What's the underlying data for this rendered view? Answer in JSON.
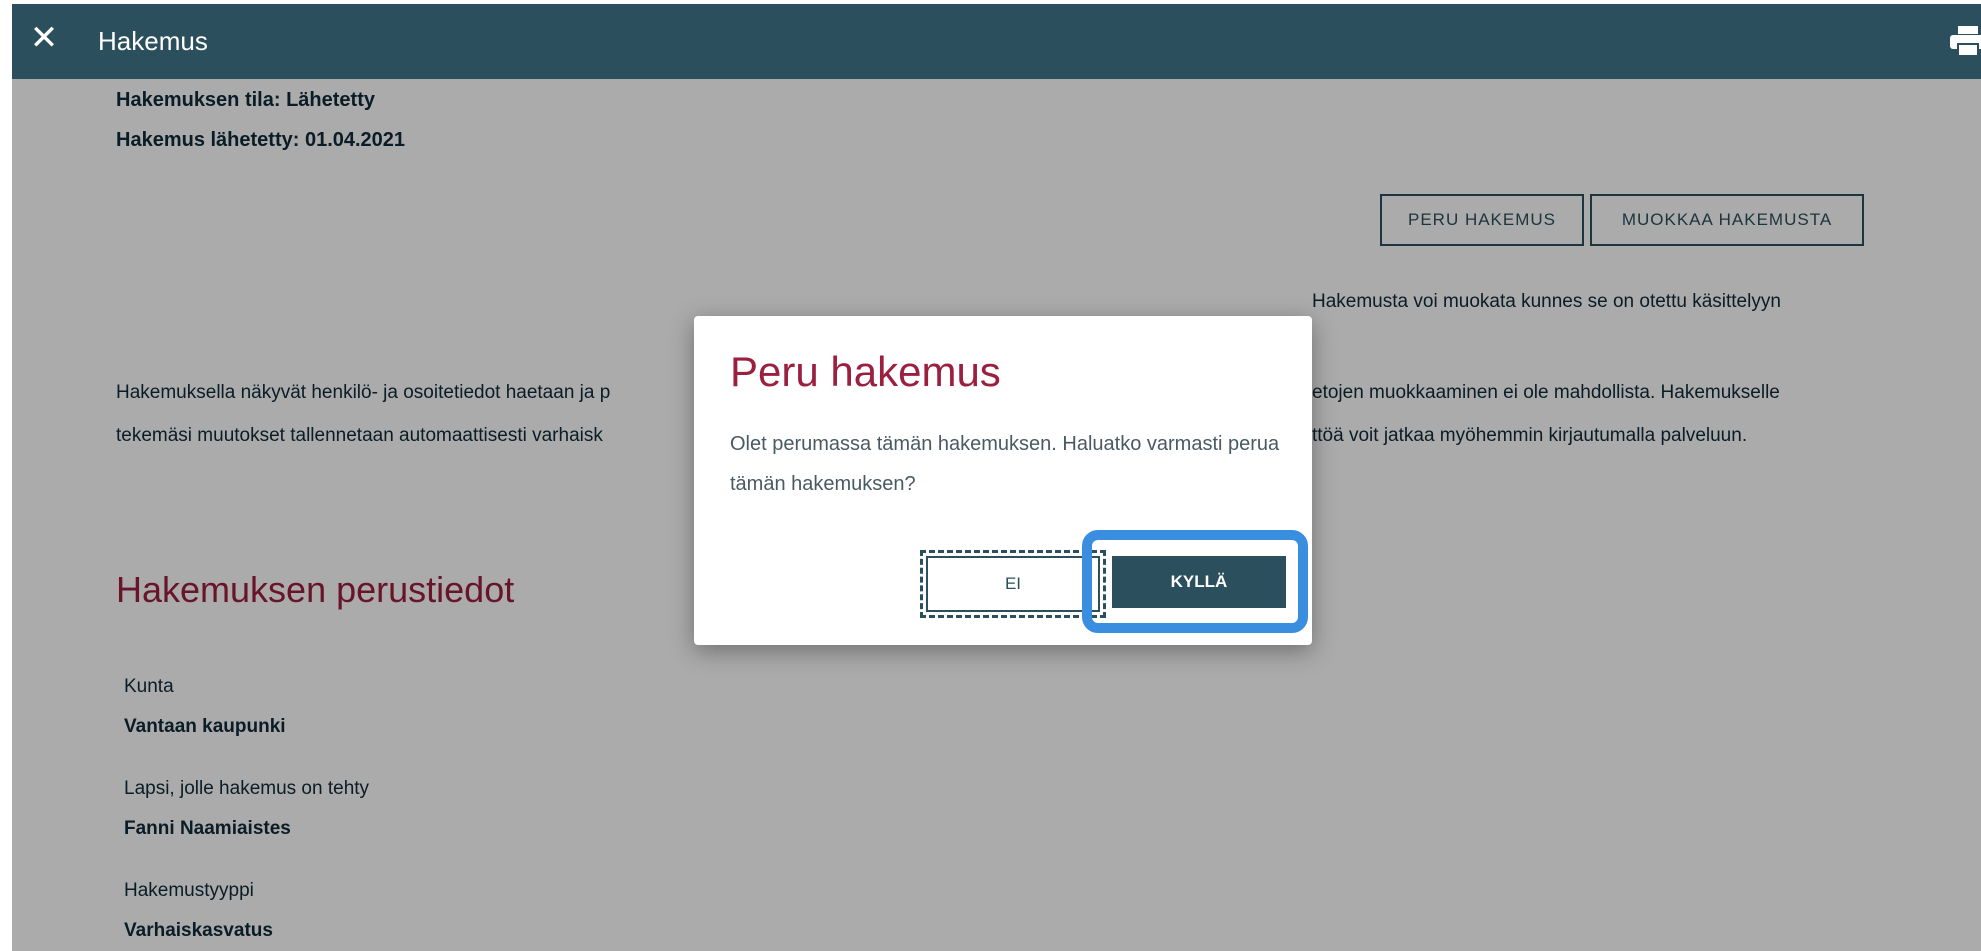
{
  "header": {
    "close_icon": "close-icon",
    "title": "Hakemus",
    "print_icon": "printer-icon"
  },
  "status": {
    "state_line": "Hakemuksen tila: Lähetetty",
    "sent_line": "Hakemus lähetetty: 01.04.2021"
  },
  "actions": {
    "cancel_label": "PERU HAKEMUS",
    "edit_label": "MUOKKAA HAKEMUSTA",
    "edit_hint": "Hakemusta voi muokata kunnes se on otettu käsittelyyn"
  },
  "info": {
    "line1_left": "Hakemuksella näkyvät henkilö- ja osoitetiedot haetaan ja p",
    "line1_right": "etojen muokkaaminen ei ole mahdollista. Hakemukselle",
    "line2_left": "tekemäsi muutokset tallennetaan automaattisesti varhaisk",
    "line2_right": "ttöä voit jatkaa myöhemmin kirjautumalla palveluun."
  },
  "section": {
    "title": "Hakemuksen perustiedot",
    "fields": [
      {
        "label": "Kunta",
        "value": "Vantaan kaupunki"
      },
      {
        "label": "Lapsi, jolle hakemus on tehty",
        "value": "Fanni Naamiaistes"
      },
      {
        "label": "Hakemustyyppi",
        "value": "Varhaiskasvatus"
      }
    ]
  },
  "modal": {
    "title": "Peru hakemus",
    "text": "Olet perumassa tämän hakemuksen. Haluatko varmasti perua tämän hakemuksen?",
    "no_label": "EI",
    "yes_label": "KYLLÄ"
  },
  "colors": {
    "header_bg": "#2c4f5d",
    "accent_red": "#9b1f3f",
    "focus_blue": "#3a8ee0"
  }
}
